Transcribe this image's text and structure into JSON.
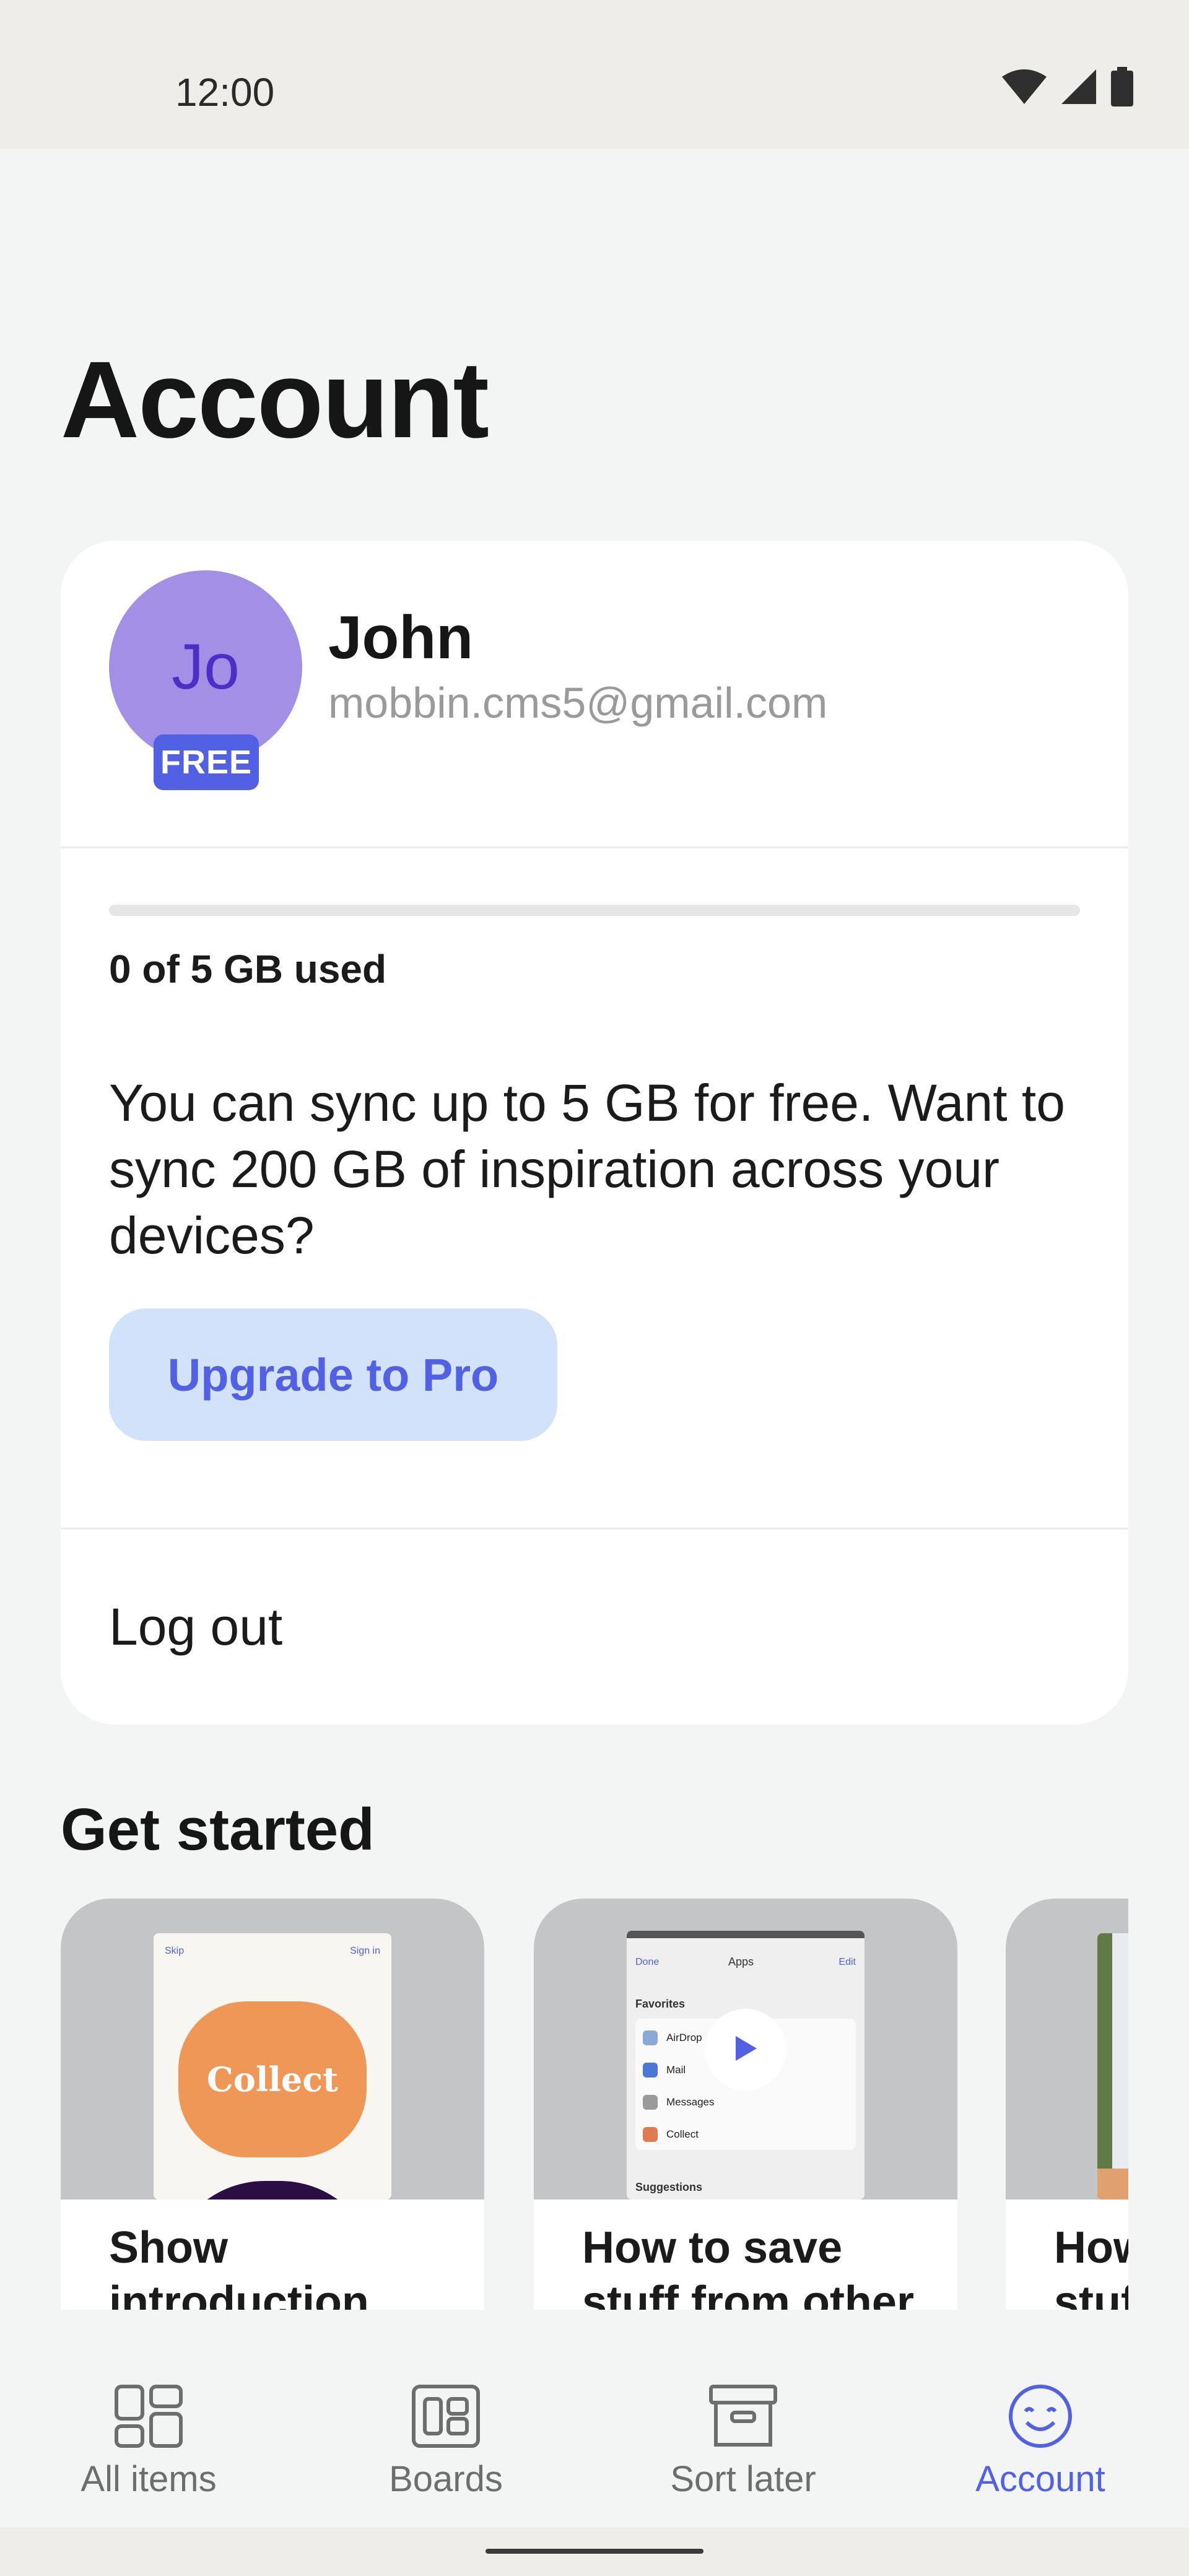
{
  "status_bar": {
    "time": "12:00",
    "icons": [
      "wifi-icon",
      "cellular-signal-icon",
      "battery-icon"
    ]
  },
  "page": {
    "title": "Account"
  },
  "profile": {
    "avatar_initials": "Jo",
    "plan_badge": "FREE",
    "name": "John",
    "email": "mobbin.cms5@gmail.com",
    "avatar_color": "#a290e6",
    "badge_color": "#5260e3"
  },
  "storage": {
    "used_fraction": 0,
    "label": "0 of 5 GB used",
    "upsell_text": "You can sync up to 5 GB for free. Want to sync 200 GB of inspiration across your devices?",
    "upgrade_button": "Upgrade to Pro"
  },
  "logout_label": "Log out",
  "get_started": {
    "title": "Get started",
    "cards": [
      {
        "label": "Show introduction",
        "thumb": {
          "skip": "Skip",
          "sign_in": "Sign in",
          "headline": "Collect"
        }
      },
      {
        "label": "How to save stuff from other",
        "thumb": {
          "done": "Done",
          "title": "Apps",
          "edit": "Edit",
          "favorites": "Favorites",
          "items": [
            "AirDrop",
            "Mail",
            "Messages",
            "Collect"
          ],
          "suggestions": "Suggestions"
        }
      },
      {
        "label": "How to save stuff"
      }
    ]
  },
  "bottom_nav": {
    "items": [
      {
        "label": "All items",
        "icon": "grid-icon",
        "active": false
      },
      {
        "label": "Boards",
        "icon": "boards-icon",
        "active": false
      },
      {
        "label": "Sort later",
        "icon": "archive-box-icon",
        "active": false
      },
      {
        "label": "Account",
        "icon": "smiley-icon",
        "active": true
      }
    ]
  },
  "accent_color": "#5260e3"
}
